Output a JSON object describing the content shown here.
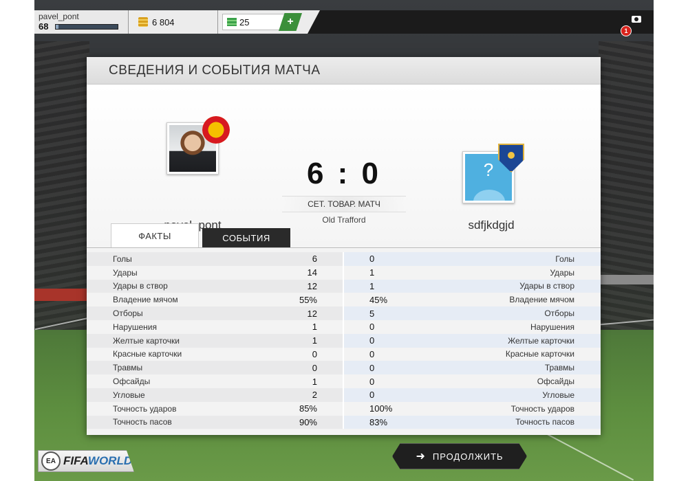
{
  "topbar": {
    "username": "pavel_pont",
    "level": "68",
    "xp_progress": 0.04,
    "coins": "6 804",
    "points": "25",
    "add_label": "+",
    "notifications": "1"
  },
  "panel": {
    "title": "СВЕДЕНИЯ И СОБЫТИЯ МАТЧА"
  },
  "match": {
    "home_name": "pavel_pont",
    "away_name": "sdfjkdgjd",
    "score": "6 : 0",
    "match_type": "СЕТ. ТОВАР. МАТЧ",
    "stadium": "Old Trafford",
    "away_avatar_glyph": "?"
  },
  "tabs": {
    "facts": "ФАКТЫ",
    "events": "СОБЫТИЯ"
  },
  "stats": [
    {
      "label": "Голы",
      "home": "6",
      "away": "0"
    },
    {
      "label": "Удары",
      "home": "14",
      "away": "1"
    },
    {
      "label": "Удары в створ",
      "home": "12",
      "away": "1"
    },
    {
      "label": "Владение мячом",
      "home": "55%",
      "away": "45%"
    },
    {
      "label": "Отборы",
      "home": "12",
      "away": "5"
    },
    {
      "label": "Нарушения",
      "home": "1",
      "away": "0"
    },
    {
      "label": "Желтые карточки",
      "home": "1",
      "away": "0"
    },
    {
      "label": "Красные карточки",
      "home": "0",
      "away": "0"
    },
    {
      "label": "Травмы",
      "home": "0",
      "away": "0"
    },
    {
      "label": "Офсайды",
      "home": "1",
      "away": "0"
    },
    {
      "label": "Угловые",
      "home": "2",
      "away": "0"
    },
    {
      "label": "Точность ударов",
      "home": "85%",
      "away": "100%"
    },
    {
      "label": "Точность пасов",
      "home": "90%",
      "away": "83%"
    }
  ],
  "footer": {
    "ea_label": "EA",
    "fifa_label": "FIFA",
    "world_label": "WORLD",
    "continue_label": "ПРОДОЛЖИТЬ"
  },
  "colors": {
    "accent_green": "#3b8f3a",
    "dark": "#1b1b1b",
    "badge_red": "#d8231c"
  },
  "icons": [
    "coins-icon",
    "points-icon",
    "plus-icon",
    "camera-icon",
    "club-crest-icon",
    "arrow-right-icon"
  ]
}
